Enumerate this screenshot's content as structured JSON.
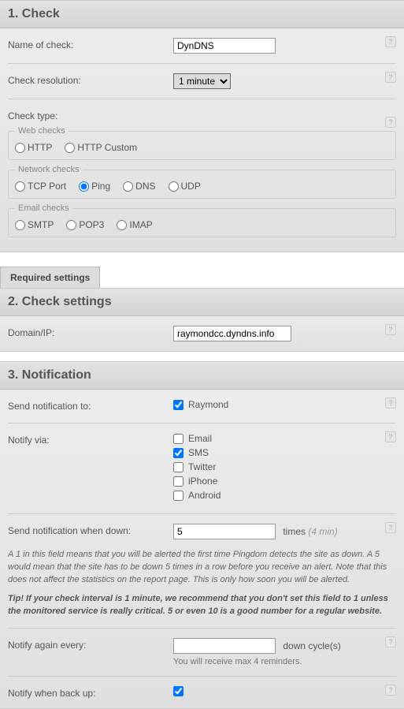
{
  "section1": {
    "title": "1. Check",
    "name_label": "Name of check:",
    "name_value": "DynDNS",
    "resolution_label": "Check resolution:",
    "resolution_value": "1 minute",
    "type_label": "Check type:",
    "fieldsets": {
      "web": {
        "legend": "Web checks",
        "options": [
          "HTTP",
          "HTTP Custom"
        ],
        "selected": ""
      },
      "net": {
        "legend": "Network checks",
        "options": [
          "TCP Port",
          "Ping",
          "DNS",
          "UDP"
        ],
        "selected": "Ping"
      },
      "email": {
        "legend": "Email checks",
        "options": [
          "SMTP",
          "POP3",
          "IMAP"
        ],
        "selected": ""
      }
    }
  },
  "tab_label": "Required settings",
  "section2": {
    "title": "2. Check settings",
    "domain_label": "Domain/IP:",
    "domain_value": "raymondcc.dyndns.info"
  },
  "section3": {
    "title": "3. Notification",
    "sendto_label": "Send notification to:",
    "sendto_name": "Raymond",
    "sendto_checked": true,
    "via_label": "Notify via:",
    "via_options": [
      {
        "label": "Email",
        "checked": false
      },
      {
        "label": "SMS",
        "checked": true
      },
      {
        "label": "Twitter",
        "checked": false
      },
      {
        "label": "iPhone",
        "checked": false
      },
      {
        "label": "Android",
        "checked": false
      }
    ],
    "whendown_label": "Send notification when down:",
    "whendown_value": "5",
    "whendown_times": "times",
    "whendown_hint": "(4 min)",
    "explain": "A 1 in this field means that you will be alerted the first time Pingdom detects the site as down. A 5 would mean that the site has to be down 5 times in a row before you receive an alert. Note that this does not affect the statistics on the report page. This is only how soon you will be alerted.",
    "tip": "Tip! If your check interval is 1 minute, we recommend that you don't set this field to 1 unless the monitored service is really critical. 5 or even 10 is a good number for a regular website.",
    "again_label": "Notify again every:",
    "again_value": "",
    "again_suffix": "down cycle(s)",
    "again_sub": "You will receive max 4 reminders.",
    "backup_label": "Notify when back up:",
    "backup_checked": true
  }
}
